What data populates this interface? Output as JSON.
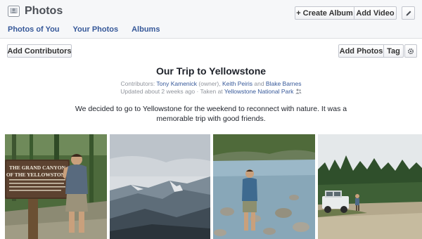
{
  "header": {
    "title": "Photos",
    "icon": "photos-icon",
    "create_album_label": "+ Create Album",
    "add_video_label": "Add Video",
    "edit_icon": "pencil-icon"
  },
  "tabs": [
    {
      "label": "Photos of You"
    },
    {
      "label": "Your Photos"
    },
    {
      "label": "Albums"
    }
  ],
  "toolbar": {
    "add_contributors_label": "Add Contributors",
    "add_photos_label": "Add Photos",
    "tag_label": "Tag",
    "settings_icon": "gear-icon"
  },
  "album": {
    "title": "Our Trip to Yellowstone",
    "contributors_prefix": "Contributors:",
    "contributor_owner": "Tony Kamenick",
    "owner_suffix": "(owner),",
    "contributor_2": "Keith Peiris",
    "and_text": "and",
    "contributor_3": "Blake Barnes",
    "updated_text": "Updated about 2 weeks ago · Taken at",
    "location": "Yellowstone National Park",
    "privacy_icon": "friends-icon",
    "description": "We decided to go to Yellowstone for the weekend to reconnect with nature. It was a memorable trip with good friends.",
    "sign_text": "THE GRAND CANYON OF THE YELLOWSTONE"
  },
  "colors": {
    "link": "#365899",
    "header_bg": "#f6f7f9",
    "meta": "#90949c"
  }
}
